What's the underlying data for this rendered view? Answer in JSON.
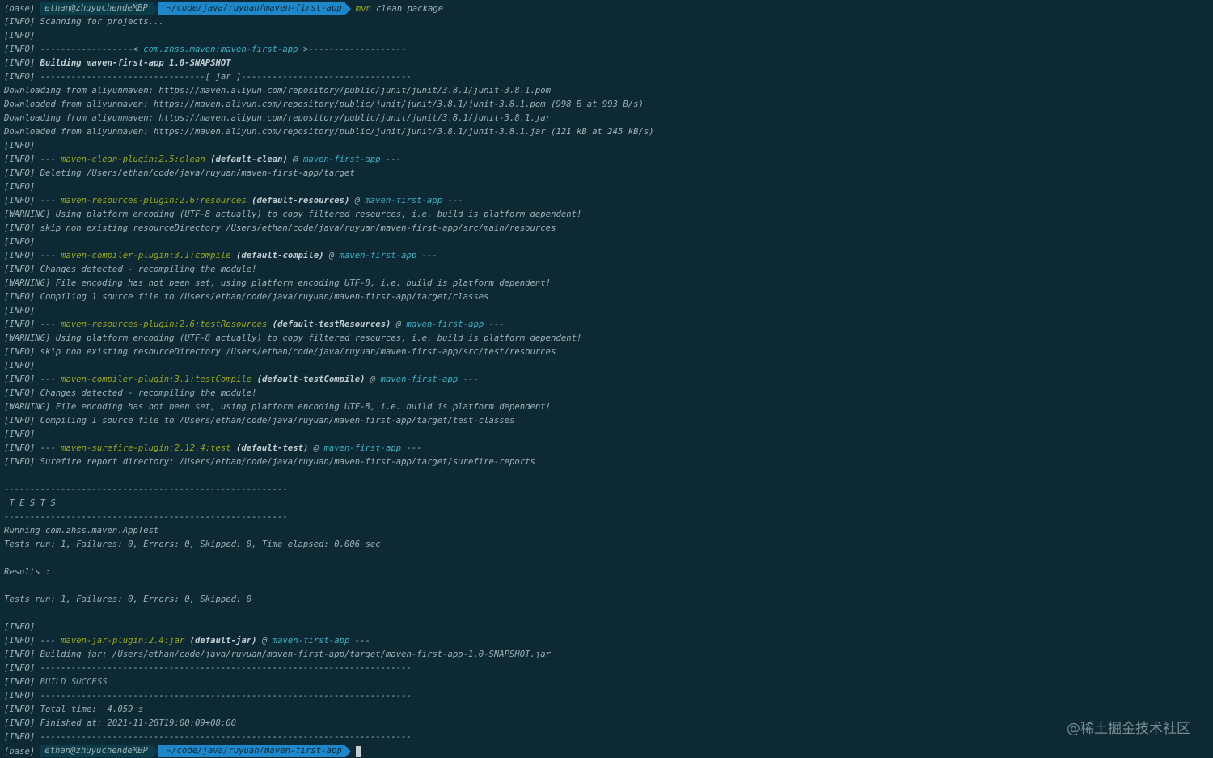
{
  "prompt": {
    "base": "(base)",
    "user": "ethan@zhuyuchendeMBP",
    "dir": "~/code/java/ruyuan/maven-first-app",
    "cmd": "mvn",
    "args": " clean package"
  },
  "lines": [
    [
      {
        "t": "[INFO] Scanning for projects..."
      }
    ],
    [
      {
        "t": "[INFO]"
      }
    ],
    [
      {
        "t": "[INFO] ------------------< "
      },
      {
        "t": "com.zhss.maven:maven-first-app",
        "c": "teal"
      },
      {
        "t": " >-------------------"
      }
    ],
    [
      {
        "t": "[INFO] "
      },
      {
        "t": "Building maven-first-app 1.0-SNAPSHOT",
        "c": "bold"
      }
    ],
    [
      {
        "t": "[INFO] --------------------------------[ jar ]---------------------------------"
      }
    ],
    [
      {
        "t": "Downloading from aliyunmaven: https://maven.aliyun.com/repository/public/junit/junit/3.8.1/junit-3.8.1.pom"
      }
    ],
    [
      {
        "t": "Downloaded from aliyunmaven: https://maven.aliyun.com/repository/public/junit/junit/3.8.1/junit-3.8.1.pom (998 B at 993 B/s)"
      }
    ],
    [
      {
        "t": "Downloading from aliyunmaven: https://maven.aliyun.com/repository/public/junit/junit/3.8.1/junit-3.8.1.jar"
      }
    ],
    [
      {
        "t": "Downloaded from aliyunmaven: https://maven.aliyun.com/repository/public/junit/junit/3.8.1/junit-3.8.1.jar (121 kB at 245 kB/s)"
      }
    ],
    [
      {
        "t": "[INFO]"
      }
    ],
    [
      {
        "t": "[INFO] --- "
      },
      {
        "t": "maven-clean-plugin:2.5:clean",
        "c": "green"
      },
      {
        "t": " "
      },
      {
        "t": "(default-clean)",
        "c": "bold"
      },
      {
        "t": " @ "
      },
      {
        "t": "maven-first-app",
        "c": "teal"
      },
      {
        "t": " ---"
      }
    ],
    [
      {
        "t": "[INFO] Deleting /Users/ethan/code/java/ruyuan/maven-first-app/target"
      }
    ],
    [
      {
        "t": "[INFO]"
      }
    ],
    [
      {
        "t": "[INFO] --- "
      },
      {
        "t": "maven-resources-plugin:2.6:resources",
        "c": "green"
      },
      {
        "t": " "
      },
      {
        "t": "(default-resources)",
        "c": "bold"
      },
      {
        "t": " @ "
      },
      {
        "t": "maven-first-app",
        "c": "teal"
      },
      {
        "t": " ---"
      }
    ],
    [
      {
        "t": "[WARNING] Using platform encoding (UTF-8 actually) to copy filtered resources, i.e. build is platform dependent!"
      }
    ],
    [
      {
        "t": "[INFO] skip non existing resourceDirectory /Users/ethan/code/java/ruyuan/maven-first-app/src/main/resources"
      }
    ],
    [
      {
        "t": "[INFO]"
      }
    ],
    [
      {
        "t": "[INFO] --- "
      },
      {
        "t": "maven-compiler-plugin:3.1:compile",
        "c": "green"
      },
      {
        "t": " "
      },
      {
        "t": "(default-compile)",
        "c": "bold"
      },
      {
        "t": " @ "
      },
      {
        "t": "maven-first-app",
        "c": "teal"
      },
      {
        "t": " ---"
      }
    ],
    [
      {
        "t": "[INFO] Changes detected - recompiling the module!"
      }
    ],
    [
      {
        "t": "[WARNING] File encoding has not been set, using platform encoding UTF-8, i.e. build is platform dependent!"
      }
    ],
    [
      {
        "t": "[INFO] Compiling 1 source file to /Users/ethan/code/java/ruyuan/maven-first-app/target/classes"
      }
    ],
    [
      {
        "t": "[INFO]"
      }
    ],
    [
      {
        "t": "[INFO] --- "
      },
      {
        "t": "maven-resources-plugin:2.6:testResources",
        "c": "green"
      },
      {
        "t": " "
      },
      {
        "t": "(default-testResources)",
        "c": "bold"
      },
      {
        "t": " @ "
      },
      {
        "t": "maven-first-app",
        "c": "teal"
      },
      {
        "t": " ---"
      }
    ],
    [
      {
        "t": "[WARNING] Using platform encoding (UTF-8 actually) to copy filtered resources, i.e. build is platform dependent!"
      }
    ],
    [
      {
        "t": "[INFO] skip non existing resourceDirectory /Users/ethan/code/java/ruyuan/maven-first-app/src/test/resources"
      }
    ],
    [
      {
        "t": "[INFO]"
      }
    ],
    [
      {
        "t": "[INFO] --- "
      },
      {
        "t": "maven-compiler-plugin:3.1:testCompile",
        "c": "green"
      },
      {
        "t": " "
      },
      {
        "t": "(default-testCompile)",
        "c": "bold"
      },
      {
        "t": " @ "
      },
      {
        "t": "maven-first-app",
        "c": "teal"
      },
      {
        "t": " ---"
      }
    ],
    [
      {
        "t": "[INFO] Changes detected - recompiling the module!"
      }
    ],
    [
      {
        "t": "[WARNING] File encoding has not been set, using platform encoding UTF-8, i.e. build is platform dependent!"
      }
    ],
    [
      {
        "t": "[INFO] Compiling 1 source file to /Users/ethan/code/java/ruyuan/maven-first-app/target/test-classes"
      }
    ],
    [
      {
        "t": "[INFO]"
      }
    ],
    [
      {
        "t": "[INFO] --- "
      },
      {
        "t": "maven-surefire-plugin:2.12.4:test",
        "c": "green"
      },
      {
        "t": " "
      },
      {
        "t": "(default-test)",
        "c": "bold"
      },
      {
        "t": " @ "
      },
      {
        "t": "maven-first-app",
        "c": "teal"
      },
      {
        "t": " ---"
      }
    ],
    [
      {
        "t": "[INFO] Surefire report directory: /Users/ethan/code/java/ruyuan/maven-first-app/target/surefire-reports"
      }
    ],
    [
      {
        "t": ""
      }
    ],
    [
      {
        "t": "-------------------------------------------------------"
      }
    ],
    [
      {
        "t": " T E S T S"
      }
    ],
    [
      {
        "t": "-------------------------------------------------------"
      }
    ],
    [
      {
        "t": "Running com.zhss.maven.AppTest"
      }
    ],
    [
      {
        "t": "Tests run: 1, Failures: 0, Errors: 0, Skipped: 0, Time elapsed: 0.006 sec"
      }
    ],
    [
      {
        "t": ""
      }
    ],
    [
      {
        "t": "Results :"
      }
    ],
    [
      {
        "t": ""
      }
    ],
    [
      {
        "t": "Tests run: 1, Failures: 0, Errors: 0, Skipped: 0"
      }
    ],
    [
      {
        "t": ""
      }
    ],
    [
      {
        "t": "[INFO]"
      }
    ],
    [
      {
        "t": "[INFO] --- "
      },
      {
        "t": "maven-jar-plugin:2.4:jar",
        "c": "green"
      },
      {
        "t": " "
      },
      {
        "t": "(default-jar)",
        "c": "bold"
      },
      {
        "t": " @ "
      },
      {
        "t": "maven-first-app",
        "c": "teal"
      },
      {
        "t": " ---"
      }
    ],
    [
      {
        "t": "[INFO] Building jar: /Users/ethan/code/java/ruyuan/maven-first-app/target/maven-first-app-1.0-SNAPSHOT.jar"
      }
    ],
    [
      {
        "t": "[INFO] ------------------------------------------------------------------------"
      }
    ],
    [
      {
        "t": "[INFO] "
      },
      {
        "t": "BUILD SUCCESS",
        "c": "warn"
      }
    ],
    [
      {
        "t": "[INFO] ------------------------------------------------------------------------"
      }
    ],
    [
      {
        "t": "[INFO] Total time:  4.059 s"
      }
    ],
    [
      {
        "t": "[INFO] Finished at: 2021-11-28T19:00:09+08:00"
      }
    ],
    [
      {
        "t": "[INFO] ------------------------------------------------------------------------"
      }
    ]
  ],
  "watermark": "@稀土掘金技术社区"
}
